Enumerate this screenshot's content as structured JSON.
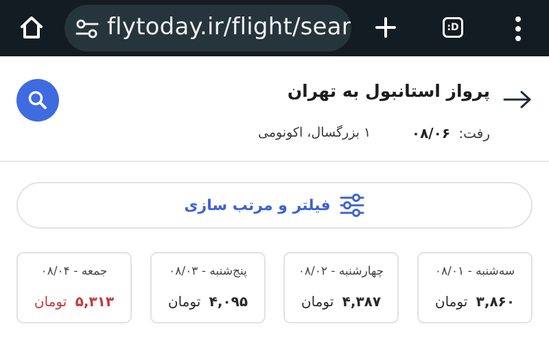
{
  "browser": {
    "url": "flytoday.ir/flight/searcl",
    "tabs_label": ":D"
  },
  "header": {
    "route_title": "پرواز استانبول به تهران",
    "depart_label": "رفت:",
    "depart_date": "۰۸/۰۶",
    "passengers": "۱ بزرگسال، اکونومی"
  },
  "filter": {
    "label": "فیلتر و مرتب سازی"
  },
  "date_cards": [
    {
      "day": "سه‌شنبه - ۰۸/۰۱",
      "price": "۳,۸۶۰",
      "currency": "تومان",
      "price_color": "#2a2a2a"
    },
    {
      "day": "چهارشنبه - ۰۸/۰۲",
      "price": "۴,۳۸۷",
      "currency": "تومان",
      "price_color": "#2a2a2a"
    },
    {
      "day": "پنج‌شنبه - ۰۸/۰۳",
      "price": "۴,۰۹۵",
      "currency": "تومان",
      "price_color": "#2a2a2a"
    },
    {
      "day": "جمعه - ۰۸/۰۴",
      "price": "۵,۳۱۳",
      "currency": "تومان",
      "price_color": "#c43a3a"
    }
  ],
  "colors": {
    "accent": "#3e6be0",
    "toolbar": "#131c22",
    "highlight_price": "#c43a3a"
  },
  "icons": {
    "home": "home-icon",
    "site_settings": "tune-icon",
    "new_tab": "plus-icon",
    "tabs": "tab-switcher-icon",
    "menu": "more-vert-icon",
    "search": "search-icon",
    "back": "arrow-right-icon",
    "filter": "sliders-icon"
  }
}
